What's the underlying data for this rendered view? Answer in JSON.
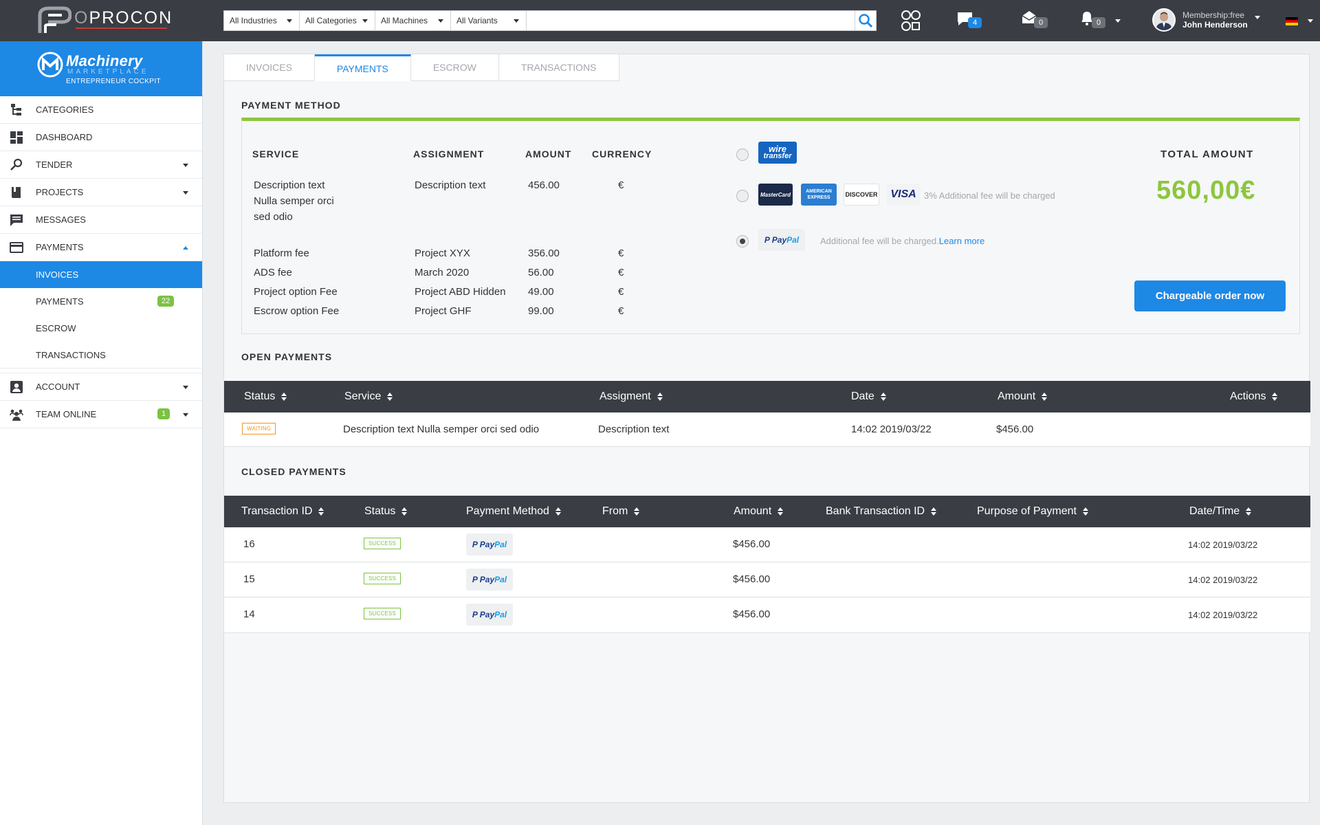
{
  "app": {
    "logo_prefix": "O",
    "logo_rest": "PROCON"
  },
  "filters": [
    {
      "label": "All Industries"
    },
    {
      "label": "All Categories"
    },
    {
      "label": "All Machines"
    },
    {
      "label": "All Variants"
    }
  ],
  "search": {
    "value": "",
    "placeholder": ""
  },
  "header": {
    "chat_count": "4",
    "mail_count": "0",
    "notification_count": "0",
    "membership": "Membership:free",
    "user_name": "John Henderson"
  },
  "brand": {
    "title": "Machinery",
    "subtitle": "MARKETPLACE",
    "tagline": "ENTREPRENEUR COCKPIT"
  },
  "sidebar": {
    "items": [
      {
        "label": "CATEGORIES",
        "icon": "categories-tree-icon"
      },
      {
        "label": "DASHBOARD",
        "icon": "dashboard-grid-icon"
      },
      {
        "label": "TENDER",
        "icon": "search-icon"
      },
      {
        "label": "PROJECTS",
        "icon": "book-icon"
      },
      {
        "label": "MESSAGES",
        "icon": "chat-icon"
      },
      {
        "label": "PAYMENTS",
        "icon": "credit-card-icon"
      }
    ],
    "payments_sub": [
      {
        "label": "INVOICES"
      },
      {
        "label": "PAYMENTS",
        "badge": "22"
      },
      {
        "label": "ESCROW"
      },
      {
        "label": "TRANSACTIONS"
      }
    ],
    "account": {
      "label": "ACCOUNT",
      "icon": "account-icon"
    },
    "team": {
      "label": "TEAM ONLINE",
      "badge": "1",
      "icon": "team-icon"
    }
  },
  "tabs": [
    {
      "label": "INVOICES"
    },
    {
      "label": "PAYMENTS"
    },
    {
      "label": "ESCROW"
    },
    {
      "label": "TRANSACTIONS"
    }
  ],
  "payment_method": {
    "title": "PAYMENT METHOD",
    "headers": {
      "service": "SERVICE",
      "assignment": "ASSIGNMENT",
      "amount": "AMOUNT",
      "currency": "CURRENCY"
    },
    "main_item": {
      "service_lines": [
        "Description text",
        "Nulla semper orci",
        "sed odio"
      ],
      "assignment": "Description text",
      "amount": "456.00",
      "currency": "€"
    },
    "fees": [
      {
        "service": "Platform fee",
        "assignment": "Project XYX",
        "amount": "356.00",
        "currency": "€"
      },
      {
        "service": "ADS fee",
        "assignment": "March 2020",
        "amount": "56.00",
        "currency": "€"
      },
      {
        "service": "Project option Fee",
        "assignment": "Project ABD Hidden",
        "amount": "49.00",
        "currency": "€"
      },
      {
        "service": "Escrow option Fee",
        "assignment": "Project GHF",
        "amount": "99.00",
        "currency": "€"
      }
    ],
    "methods": {
      "wire_line1": "wire",
      "wire_line2": "transfer",
      "mastercard": "MasterCard",
      "amex_line1": "AMERICAN",
      "amex_line2": "EXPRESS",
      "discover": "DISCOVER",
      "visa": "VISA",
      "cards_note": "3% Additional fee will be charged",
      "paypal_note": "Additional fee will be charged.",
      "learn_more": "Learn more",
      "selected": "paypal"
    },
    "total_label": "TOTAL AMOUNT",
    "total_amount": "560,00€",
    "cta": "Chargeable order now"
  },
  "open_payments": {
    "title": "OPEN PAYMENTS",
    "columns": [
      "Status",
      "Service",
      "Assigment",
      "Date",
      "Amount",
      "Actions"
    ],
    "rows": [
      {
        "status": "WAITING",
        "service": "Description text Nulla semper orci sed odio",
        "assignment": "Description text",
        "date": "14:02 2019/03/22",
        "amount": "$456.00"
      }
    ]
  },
  "closed_payments": {
    "title": "CLOSED PAYMENTS",
    "columns": [
      "Transaction ID",
      "Status",
      "Payment Method",
      "From",
      "Amount",
      "Bank Transaction ID",
      "Purpose of Payment",
      "Date/Time"
    ],
    "rows": [
      {
        "id": "16",
        "status": "SUCCESS",
        "method_a": "Pay",
        "method_b": "Pal",
        "amount": "$456.00",
        "datetime": "14:02 2019/03/22"
      },
      {
        "id": "15",
        "status": "SUCCESS",
        "method_a": "Pay",
        "method_b": "Pal",
        "amount": "$456.00",
        "datetime": "14:02 2019/03/22"
      },
      {
        "id": "14",
        "status": "SUCCESS",
        "method_a": "Pay",
        "method_b": "Pal",
        "amount": "$456.00",
        "datetime": "14:02 2019/03/22"
      }
    ]
  },
  "colors": {
    "accent": "#1e88e5",
    "topbar": "#3a3d43",
    "success": "#7cc242",
    "total": "#8dc63f",
    "waiting": "#f0961e"
  }
}
